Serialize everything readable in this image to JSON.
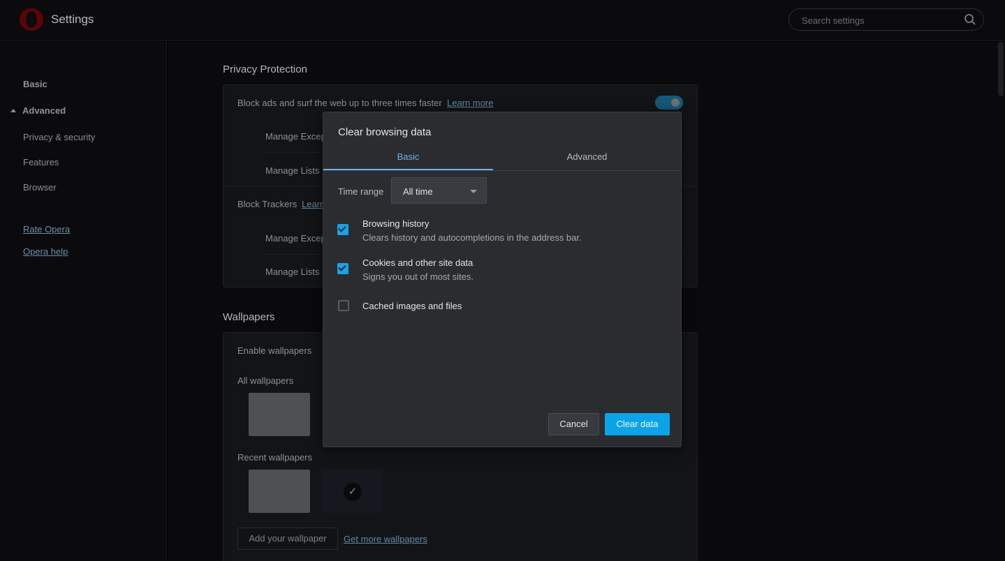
{
  "header": {
    "title": "Settings",
    "search_placeholder": "Search settings"
  },
  "sidebar": {
    "items": [
      {
        "label": "Basic"
      },
      {
        "label": "Advanced"
      },
      {
        "label": "Privacy & security"
      },
      {
        "label": "Features"
      },
      {
        "label": "Browser"
      }
    ],
    "links": [
      {
        "label": "Rate Opera"
      },
      {
        "label": "Opera help"
      }
    ]
  },
  "privacy": {
    "title": "Privacy Protection",
    "block_ads_text": "Block ads and surf the web up to three times faster",
    "learn_more": "Learn more",
    "manage_exceptions": "Manage Excep",
    "manage_lists": "Manage Lists",
    "block_trackers": "Block Trackers",
    "learn_trackers": "Learn",
    "manage_exceptions_2": "Manage Excep",
    "manage_lists_2": "Manage Lists"
  },
  "wallpapers": {
    "title": "Wallpapers",
    "enable": "Enable wallpapers",
    "all": "All wallpapers",
    "recent": "Recent wallpapers",
    "add_button": "Add your wallpaper",
    "get_more": "Get more wallpapers"
  },
  "dialog": {
    "title": "Clear browsing data",
    "tabs": [
      {
        "label": "Basic",
        "active": true
      },
      {
        "label": "Advanced",
        "active": false
      }
    ],
    "time_range_label": "Time range",
    "time_range_value": "All time",
    "options": [
      {
        "title": "Browsing history",
        "desc": "Clears history and autocompletions in the address bar.",
        "checked": true
      },
      {
        "title": "Cookies and other site data",
        "desc": "Signs you out of most sites.",
        "checked": true
      },
      {
        "title": "Cached images and files",
        "desc": "",
        "checked": false
      }
    ],
    "cancel": "Cancel",
    "clear": "Clear data"
  },
  "colors": {
    "accent": "#0ba4e8",
    "tab_active": "#6cb0e8",
    "brand": "#5c0408"
  }
}
